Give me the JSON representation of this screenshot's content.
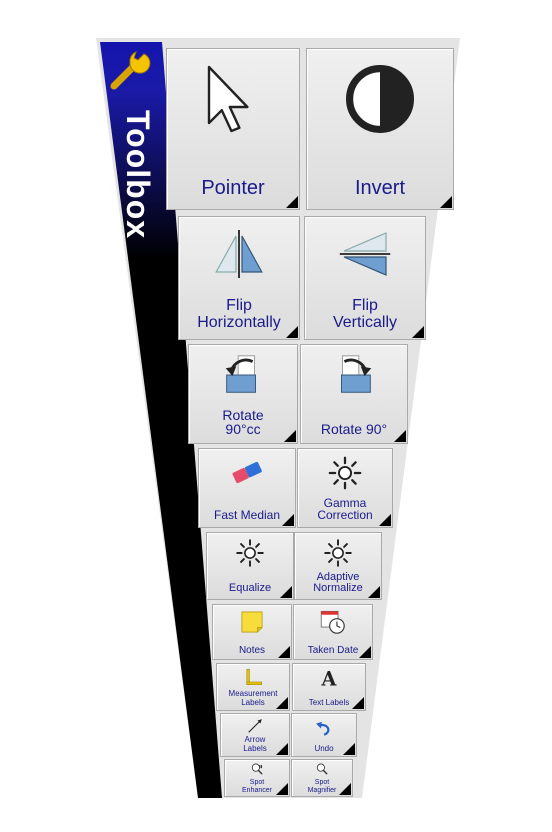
{
  "panel": {
    "title": "Toolbox",
    "colors": {
      "header_top": "#0f0fb0",
      "header_bottom": "#000000",
      "label": "#1a1a8c",
      "tile_bg": "#e4e4e4"
    }
  },
  "tools": [
    {
      "id": "pointer",
      "label": "Pointer",
      "icon": "pointer-arrow-icon"
    },
    {
      "id": "invert",
      "label": "Invert",
      "icon": "half-circle-invert-icon"
    },
    {
      "id": "flip-h",
      "label": "Flip\nHorizontally",
      "icon": "flip-horizontal-icon"
    },
    {
      "id": "flip-v",
      "label": "Flip\nVertically",
      "icon": "flip-vertical-icon"
    },
    {
      "id": "rotate-ccw",
      "label": "Rotate\n90°cc",
      "icon": "rotate-ccw-icon"
    },
    {
      "id": "rotate-cw",
      "label": "Rotate 90°",
      "icon": "rotate-cw-icon"
    },
    {
      "id": "fast-median",
      "label": "Fast Median",
      "icon": "eraser-icon"
    },
    {
      "id": "gamma",
      "label": "Gamma\nCorrection",
      "icon": "sun-icon"
    },
    {
      "id": "equalize",
      "label": "Equalize",
      "icon": "sun-icon"
    },
    {
      "id": "adaptive-normalize",
      "label": "Adaptive\nNormalize",
      "icon": "sun-icon"
    },
    {
      "id": "notes",
      "label": "Notes",
      "icon": "sticky-note-icon"
    },
    {
      "id": "taken-date",
      "label": "Taken Date",
      "icon": "calendar-clock-icon"
    },
    {
      "id": "measurement-labels",
      "label": "Measurement\nLabels",
      "icon": "ruler-icon"
    },
    {
      "id": "text-labels",
      "label": "Text Labels",
      "icon": "letter-a-icon"
    },
    {
      "id": "arrow-labels",
      "label": "Arrow\nLabels",
      "icon": "arrow-label-icon"
    },
    {
      "id": "undo",
      "label": "Undo",
      "icon": "undo-icon"
    },
    {
      "id": "spot-enhancer",
      "label": "Spot\nEnhancer",
      "icon": "magnifier-spot-icon"
    },
    {
      "id": "spot-magnifier",
      "label": "Spot\nMagnifier",
      "icon": "magnifier-icon"
    }
  ]
}
